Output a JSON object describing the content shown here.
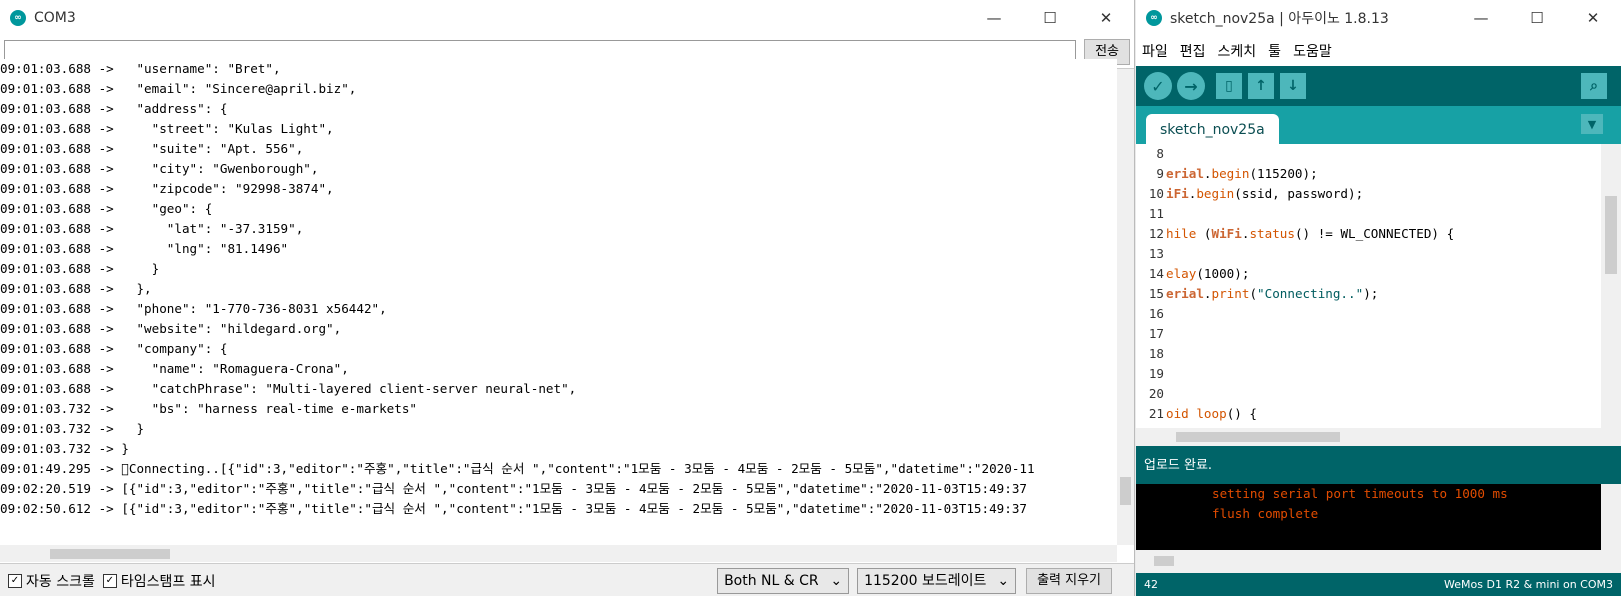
{
  "serial": {
    "title": "COM3",
    "send_label": "전송",
    "lines": [
      "09:01:03.688 ->   \"username\": \"Bret\",",
      "09:01:03.688 ->   \"email\": \"Sincere@april.biz\",",
      "09:01:03.688 ->   \"address\": {",
      "09:01:03.688 ->     \"street\": \"Kulas Light\",",
      "09:01:03.688 ->     \"suite\": \"Apt. 556\",",
      "09:01:03.688 ->     \"city\": \"Gwenborough\",",
      "09:01:03.688 ->     \"zipcode\": \"92998-3874\",",
      "09:01:03.688 ->     \"geo\": {",
      "09:01:03.688 ->       \"lat\": \"-37.3159\",",
      "09:01:03.688 ->       \"lng\": \"81.1496\"",
      "09:01:03.688 ->     }",
      "09:01:03.688 ->   },",
      "09:01:03.688 ->   \"phone\": \"1-770-736-8031 x56442\",",
      "09:01:03.688 ->   \"website\": \"hildegard.org\",",
      "09:01:03.688 ->   \"company\": {",
      "09:01:03.688 ->     \"name\": \"Romaguera-Crona\",",
      "09:01:03.688 ->     \"catchPhrase\": \"Multi-layered client-server neural-net\",",
      "09:01:03.732 ->     \"bs\": \"harness real-time e-markets\"",
      "09:01:03.732 ->   }",
      "09:01:03.732 -> }",
      "09:01:49.295 -> \u0000Connecting..[{\"id\":3,\"editor\":\"주홍\",\"title\":\"급식 순서 \",\"content\":\"1모둠 - 3모둠 - 4모둠 - 2모둠 - 5모둠\",\"datetime\":\"2020-11",
      "09:02:20.519 -> [{\"id\":3,\"editor\":\"주홍\",\"title\":\"급식 순서 \",\"content\":\"1모둠 - 3모둠 - 4모둠 - 2모둠 - 5모둠\",\"datetime\":\"2020-11-03T15:49:37",
      "09:02:50.612 -> [{\"id\":3,\"editor\":\"주홍\",\"title\":\"급식 순서 \",\"content\":\"1모둠 - 3모둠 - 4모둠 - 2모둠 - 5모둠\",\"datetime\":\"2020-11-03T15:49:37"
    ],
    "autoscroll_label": "자동 스크롤",
    "timestamp_label": "타임스탬프 표시",
    "line_ending": "Both NL & CR",
    "baud": "115200 보드레이트",
    "clear_label": "출력 지우기"
  },
  "ide": {
    "title": "sketch_nov25a | 아두이노 1.8.13",
    "menu": [
      "파일",
      "편집",
      "스케치",
      "툴",
      "도움말"
    ],
    "tab": "sketch_nov25a",
    "line_numbers": [
      "8",
      "9",
      "10",
      "11",
      "12",
      "13",
      "14",
      "15",
      "16",
      "17",
      "18",
      "19",
      "20",
      "21"
    ],
    "status": "업로드 완료.",
    "output": [
      "setting serial port timeouts to 1000 ms",
      "flush complete"
    ],
    "footer_line": "42",
    "footer_board": "WeMos D1 R2 & mini on COM3"
  }
}
